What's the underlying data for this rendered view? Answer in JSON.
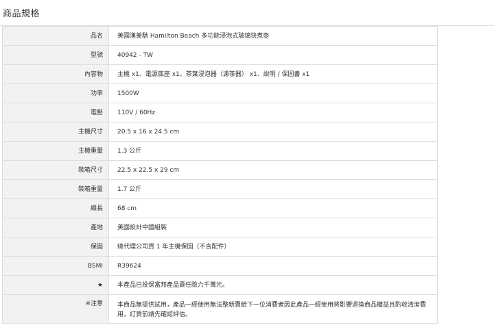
{
  "section": {
    "title": "商品規格"
  },
  "specs": [
    {
      "label": "品名",
      "value": "美國漢美馳 Hamilton Beach 多功能浸泡式玻璃快煮壺"
    },
    {
      "label": "型號",
      "value": "40942 - TW"
    },
    {
      "label": "內容物",
      "value": "主機 x1、電源底座 x1、茶葉浸泡器（濾茶器） x1、說明 / 保固書 x1"
    },
    {
      "label": "功率",
      "value": "1500W"
    },
    {
      "label": "電壓",
      "value": "110V / 60Hz"
    },
    {
      "label": "主機尺寸",
      "value": "20.5 x 16 x 24.5 cm"
    },
    {
      "label": "主機重量",
      "value": "1.3 公斤"
    },
    {
      "label": "裝箱尺寸",
      "value": "22.5 x 22.5 x 29 cm"
    },
    {
      "label": "裝箱重量",
      "value": "1.7 公斤"
    },
    {
      "label": "線長",
      "value": "68 cm"
    },
    {
      "label": "產地",
      "value": "美國設計中國組裝"
    },
    {
      "label": "保固",
      "value": "總代理公司貨 1 年主機保固（不含配件）"
    },
    {
      "label": "BSMI",
      "value": "R39624"
    },
    {
      "label": "★",
      "value": "本產品已投保富邦產品責任險六千萬元。"
    },
    {
      "label": "※注意",
      "value": "本商品無提供試用，產品一經使用無法整新賣給下一位消費者因此產品一經使用將影響退換商品權益且酌收清潔費用，訂貨前請先確認評估。"
    }
  ]
}
